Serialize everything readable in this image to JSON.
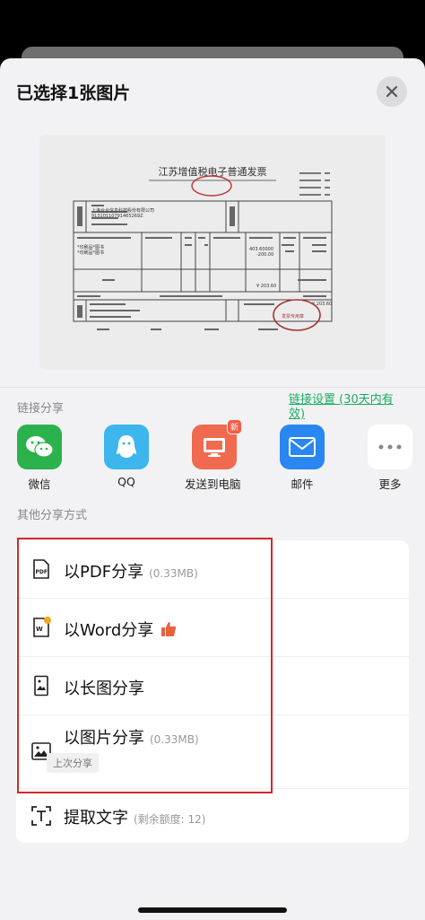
{
  "header": {
    "title": "已选择1张图片"
  },
  "invoice": {
    "title": "江苏增值税电子普通发票",
    "buyer_name": "上海合合信息科技股份有限公司",
    "tax_id": "91310110791465269Z",
    "item1": "*印刷品*图书",
    "item2": "*印刷品*图书",
    "amount1": "403.60000",
    "amount2": "-200.00",
    "total": "¥ 203.60",
    "stamp_text": "发票专用章"
  },
  "link_share": {
    "section_label": "链接分享",
    "setting_label": "链接设置 (30天内有效)"
  },
  "share_targets": [
    {
      "label": "微信",
      "icon": "wechat-icon",
      "color": "#2bb24c"
    },
    {
      "label": "QQ",
      "icon": "qq-icon",
      "color": "#3db5ed"
    },
    {
      "label": "发送到电脑",
      "icon": "computer-icon",
      "color": "#f06a4f",
      "badge": "新"
    },
    {
      "label": "邮件",
      "icon": "mail-icon",
      "color": "#2a86f0"
    },
    {
      "label": "更多",
      "icon": "more-icon",
      "color": "#ffffff"
    }
  ],
  "other_share": {
    "section_label": "其他分享方式",
    "options": [
      {
        "label": "以PDF分享",
        "size": "(0.33MB)",
        "icon": "pdf-icon"
      },
      {
        "label": "以Word分享",
        "icon": "word-icon",
        "extra_icon": "thumbs-up-icon"
      },
      {
        "label": "以长图分享",
        "icon": "long-image-icon"
      },
      {
        "label": "以图片分享",
        "size": "(0.33MB)",
        "icon": "image-icon",
        "tag": "上次分享"
      }
    ],
    "extract": {
      "label": "提取文字",
      "quota": "(剩余额度: 12)",
      "icon": "text-scan-icon"
    }
  },
  "colors": {
    "highlight": "#d32929",
    "link": "#1aad62"
  }
}
